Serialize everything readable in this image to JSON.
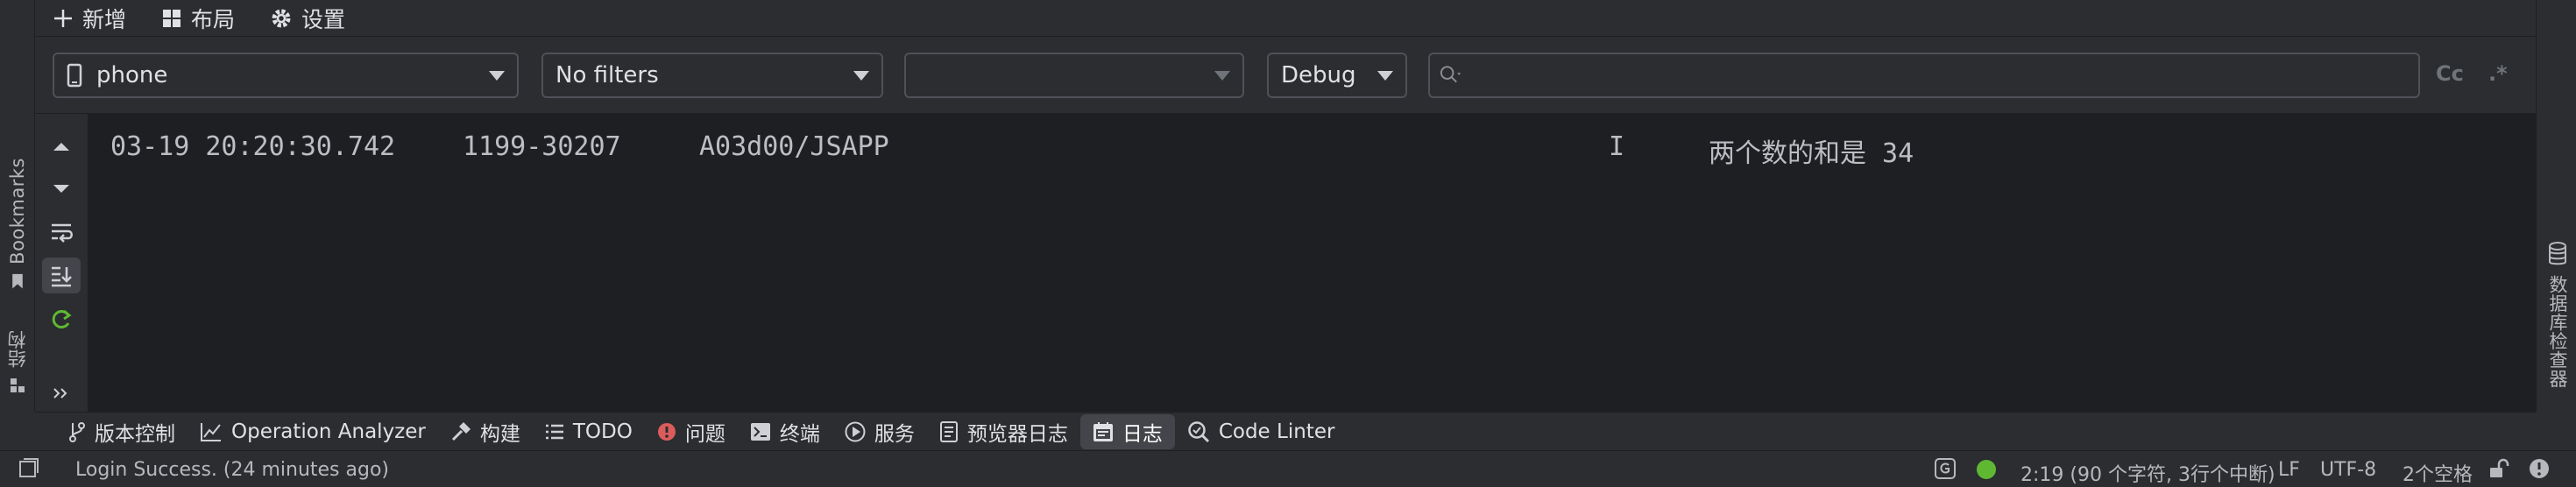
{
  "toolbar": {
    "add_label": "新增",
    "layout_label": "布局",
    "settings_label": "设置"
  },
  "left_strip": {
    "bookmarks_label": "Bookmarks",
    "structure_label": "结构"
  },
  "right_strip": {
    "database_label": "数据库检查器"
  },
  "filters": {
    "device": "phone",
    "filter_preset": "No filters",
    "process": "",
    "log_level": "Debug",
    "search_value": "",
    "case_toggle": "Cc",
    "regex_toggle": ".*"
  },
  "log": {
    "lines": [
      {
        "timestamp": "03-19 20:20:30.742",
        "pid_tid": "1199-30207",
        "tag": "A03d00/JSAPP",
        "level": "I",
        "message": "两个数的和是 34"
      }
    ]
  },
  "tool_tabs": {
    "items": [
      {
        "label": "版本控制",
        "icon": "branch-icon"
      },
      {
        "label": "Operation Analyzer",
        "icon": "chart-line-icon"
      },
      {
        "label": "构建",
        "icon": "hammer-icon"
      },
      {
        "label": "TODO",
        "icon": "list-icon"
      },
      {
        "label": "问题",
        "icon": "error-icon"
      },
      {
        "label": "终端",
        "icon": "terminal-icon"
      },
      {
        "label": "服务",
        "icon": "play-icon"
      },
      {
        "label": "预览器日志",
        "icon": "document-icon"
      },
      {
        "label": "日志",
        "icon": "log-icon",
        "active": true
      },
      {
        "label": "Code Linter",
        "icon": "linter-icon"
      }
    ]
  },
  "status": {
    "message": "Login Success. (24 minutes ago)",
    "cursor": "2:19 (90 个字符, 3行个中断)",
    "line_separator": "LF",
    "encoding": "UTF-8",
    "indent": "2个空格"
  },
  "colors": {
    "accent_green": "#5fb832",
    "error_red": "#db5c5c",
    "background": "#2b2d30",
    "log_background": "#1e1f22"
  }
}
